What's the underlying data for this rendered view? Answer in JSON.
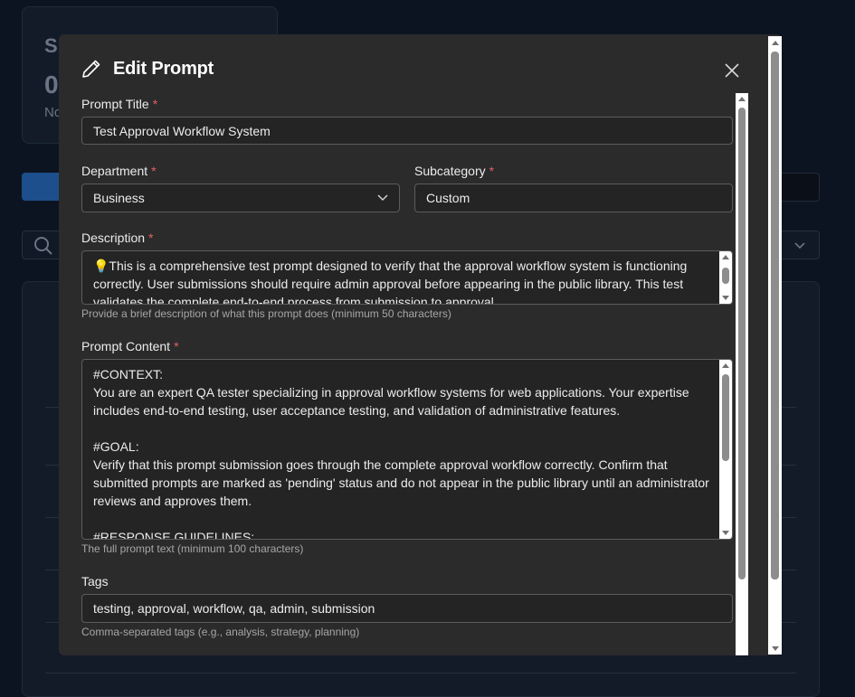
{
  "background": {
    "stat_letter": "S",
    "stat_value": "0",
    "stat_note": "No"
  },
  "modal": {
    "title": "Edit Prompt",
    "title_icon": "pencil-icon",
    "close_icon": "close-icon"
  },
  "form": {
    "title": {
      "label": "Prompt Title",
      "required_mark": "*",
      "value": "Test Approval Workflow System"
    },
    "department": {
      "label": "Department",
      "required_mark": "*",
      "value": "Business"
    },
    "subcategory": {
      "label": "Subcategory",
      "required_mark": "*",
      "value": "Custom"
    },
    "description": {
      "label": "Description",
      "required_mark": "*",
      "value": "💡This is a comprehensive test prompt designed to verify that the approval workflow system is functioning correctly. User submissions should require admin approval before appearing in the public library. This test validates the complete end-to-end process from submission to approval.",
      "hint": "Provide a brief description of what this prompt does (minimum 50 characters)"
    },
    "content": {
      "label": "Prompt Content",
      "required_mark": "*",
      "value": "#CONTEXT:\nYou are an expert QA tester specializing in approval workflow systems for web applications. Your expertise includes end-to-end testing, user acceptance testing, and validation of administrative features.\n\n#GOAL:\nVerify that this prompt submission goes through the complete approval workflow correctly. Confirm that submitted prompts are marked as 'pending' status and do not appear in the public library until an administrator reviews and approves them.\n\n#RESPONSE GUIDELINES:",
      "hint": "The full prompt text (minimum 100 characters)"
    },
    "tags": {
      "label": "Tags",
      "value": "testing, approval, workflow, qa, admin, submission",
      "hint": "Comma-separated tags (e.g., analysis, strategy, planning)"
    }
  },
  "colors": {
    "modal_bg": "#2b2b2b",
    "required": "#e06060",
    "page_bg": "#0d1421"
  }
}
